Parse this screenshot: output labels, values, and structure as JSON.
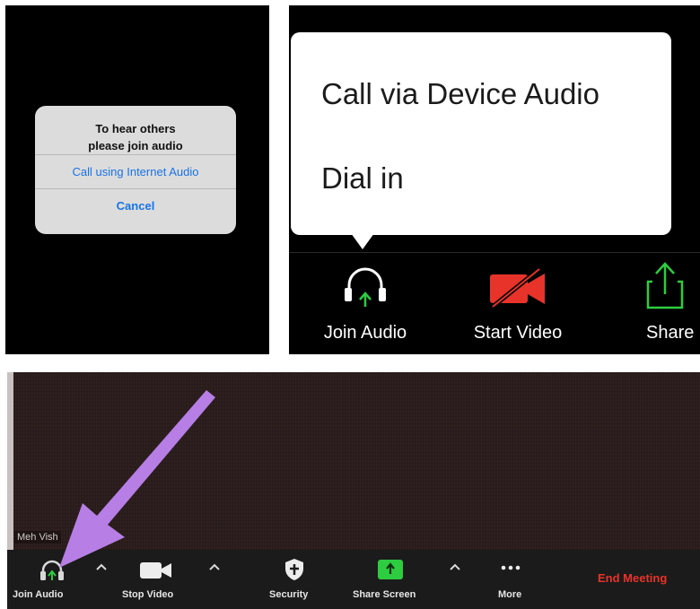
{
  "ios_dialog": {
    "title_line1": "To hear others",
    "title_line2": "please join audio",
    "internet_audio_label": "Call using Internet Audio",
    "cancel_label": "Cancel",
    "link_color": "#1a73e8"
  },
  "android": {
    "popup_options": [
      "Call via Device Audio",
      "Dial in"
    ],
    "toolbar": [
      {
        "label": "Join Audio",
        "icon": "headphones-icon"
      },
      {
        "label": "Start Video",
        "icon": "video-off-icon"
      },
      {
        "label": "Share",
        "icon": "share-icon"
      }
    ]
  },
  "desktop": {
    "participant_name": "Meh Vish",
    "toolbar": [
      {
        "label": "Join Audio",
        "icon": "headphones-icon"
      },
      {
        "label": "Stop Video",
        "icon": "video-camera-icon"
      },
      {
        "label": "Security",
        "icon": "shield-icon"
      },
      {
        "label": "Share Screen",
        "icon": "share-screen-icon"
      },
      {
        "label": "More",
        "icon": "more-dots-icon"
      }
    ],
    "end_meeting_label": "End Meeting",
    "end_meeting_color": "#e8332a",
    "annotation": "purple-arrow pointing to Join Audio"
  }
}
